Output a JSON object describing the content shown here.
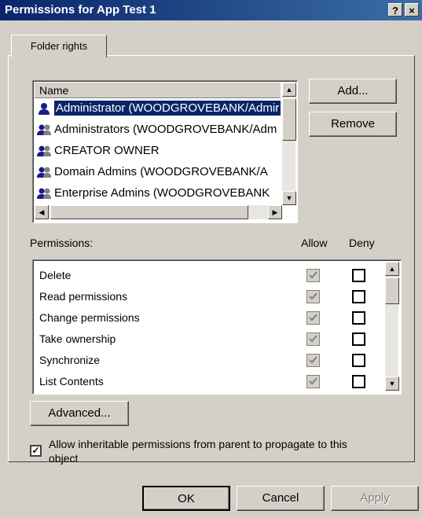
{
  "window": {
    "title": "Permissions for App Test 1",
    "help_label": "?",
    "close_label": "×"
  },
  "tabs": [
    {
      "label": "Folder rights"
    }
  ],
  "users_list": {
    "header": "Name",
    "items": [
      {
        "label": "Administrator (WOODGROVEBANK/Admir",
        "selected": true,
        "icon": "user-icon"
      },
      {
        "label": "Administrators (WOODGROVEBANK/Adm",
        "selected": false,
        "icon": "group-icon"
      },
      {
        "label": "CREATOR OWNER",
        "selected": false,
        "icon": "group-icon"
      },
      {
        "label": "Domain Admins (WOODGROVEBANK/A",
        "selected": false,
        "icon": "group-icon"
      },
      {
        "label": "Enterprise Admins (WOODGROVEBANK",
        "selected": false,
        "icon": "group-icon"
      }
    ]
  },
  "buttons": {
    "add": "Add...",
    "remove": "Remove",
    "advanced": "Advanced...",
    "ok": "OK",
    "cancel": "Cancel",
    "apply": "Apply"
  },
  "permissions": {
    "label": "Permissions:",
    "allow_header": "Allow",
    "deny_header": "Deny",
    "rows": [
      {
        "name": "Delete",
        "allow": true,
        "deny": false
      },
      {
        "name": "Read permissions",
        "allow": true,
        "deny": false
      },
      {
        "name": "Change permissions",
        "allow": true,
        "deny": false
      },
      {
        "name": "Take ownership",
        "allow": true,
        "deny": false
      },
      {
        "name": "Synchronize",
        "allow": true,
        "deny": false
      },
      {
        "name": "List Contents",
        "allow": true,
        "deny": false
      }
    ]
  },
  "inherit_checkbox": {
    "checked": true,
    "label_line1": "Allow inheritable permissions from parent to propagate to this",
    "label_line2": "object"
  },
  "colors": {
    "selection": "#0a246a",
    "face": "#d4d0c8",
    "title_start": "#0a246a",
    "title_end": "#3a6ea5"
  }
}
